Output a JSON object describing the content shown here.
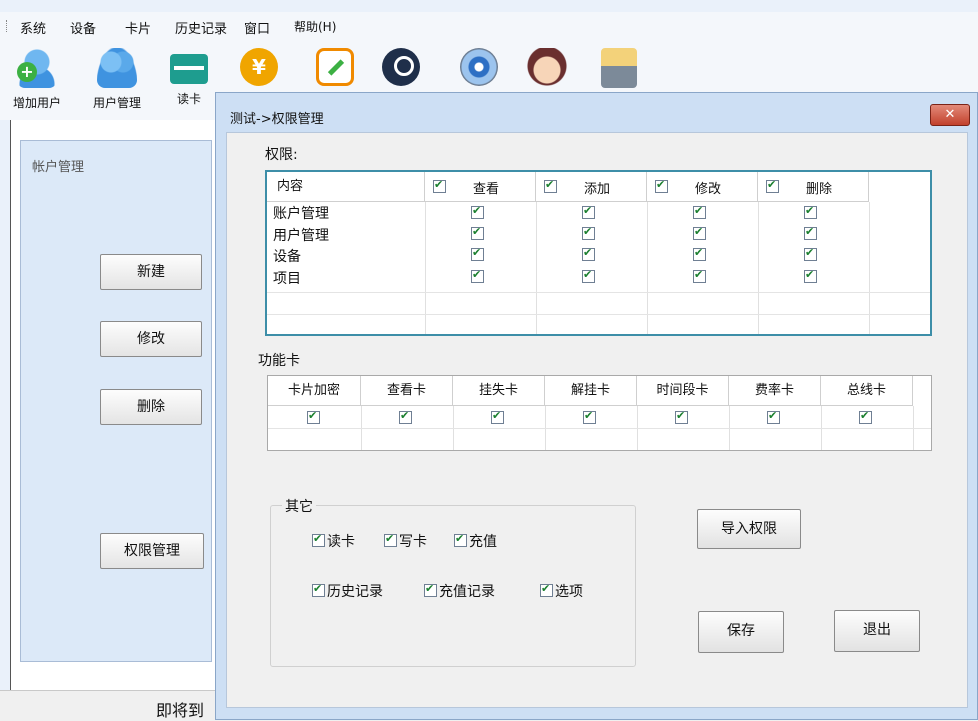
{
  "menu": {
    "items": [
      "系统",
      "设备",
      "卡片",
      "历史记录",
      "窗口",
      "帮助(H)"
    ]
  },
  "toolbar": {
    "items": [
      {
        "label": "增加用户",
        "icon": "add-user-icon"
      },
      {
        "label": "用户管理",
        "icon": "users-icon"
      },
      {
        "label": "读卡",
        "icon": "card-reader-icon"
      },
      {
        "label": "",
        "icon": "recharge-icon"
      },
      {
        "label": "",
        "icon": "edit-icon"
      },
      {
        "label": "",
        "icon": "search-icon"
      },
      {
        "label": "",
        "icon": "settings-disc-icon"
      },
      {
        "label": "",
        "icon": "person-glasses-icon"
      },
      {
        "label": "",
        "icon": "cabinet-icon"
      }
    ]
  },
  "left_panel": {
    "title": "帐户管理",
    "buttons": [
      "新建",
      "修改",
      "删除",
      "权限管理"
    ]
  },
  "status": {
    "text": "即将到"
  },
  "dialog": {
    "title": "测试->权限管理",
    "close_label": "✕",
    "permissions": {
      "label": "权限:",
      "first_col": "内容",
      "columns": [
        "查看",
        "添加",
        "修改",
        "删除"
      ],
      "rows": [
        "账户管理",
        "用户管理",
        "设备",
        "项目"
      ]
    },
    "function_cards": {
      "label": "功能卡",
      "columns": [
        "卡片加密",
        "查看卡",
        "挂失卡",
        "解挂卡",
        "时间段卡",
        "费率卡",
        "总线卡"
      ]
    },
    "other": {
      "label": "其它",
      "options_row1": [
        "读卡",
        "写卡",
        "充值"
      ],
      "options_row2": [
        "历史记录",
        "充值记录",
        "选项"
      ]
    },
    "buttons": {
      "import": "导入权限",
      "save": "保存",
      "exit": "退出"
    }
  }
}
